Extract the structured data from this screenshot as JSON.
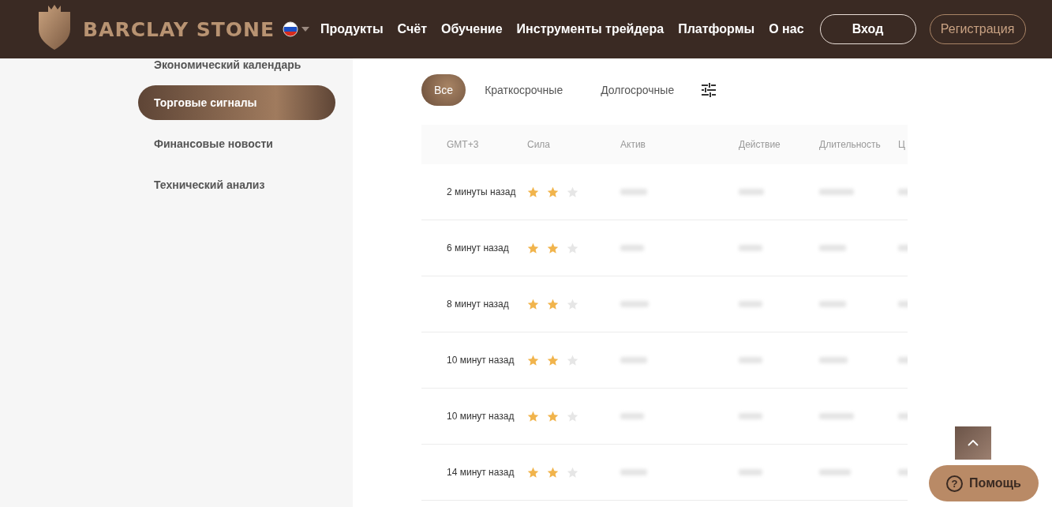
{
  "header": {
    "logo": "BARCLAY STONE",
    "nav": [
      "Продукты",
      "Счёт",
      "Обучение",
      "Инструменты трейдера",
      "Платформы",
      "О нас"
    ],
    "login": "Вход",
    "register": "Регистрация"
  },
  "sidebar": {
    "items": [
      {
        "label": "Экономический календарь",
        "selected": false
      },
      {
        "label": "Торговые сигналы",
        "selected": true
      },
      {
        "label": "Финансовые новости",
        "selected": false
      },
      {
        "label": "Технический анализ",
        "selected": false
      }
    ]
  },
  "tabs": [
    {
      "label": "Все",
      "selected": true
    },
    {
      "label": "Краткосрочные",
      "selected": false
    },
    {
      "label": "Долгосрочные",
      "selected": false
    }
  ],
  "table": {
    "columns": [
      "GMT+3",
      "Сила",
      "Актив",
      "Действие",
      "Длительность",
      "Ц"
    ],
    "rows": [
      {
        "time": "2 минуты назад",
        "stars": 2
      },
      {
        "time": "6 минут назад",
        "stars": 2
      },
      {
        "time": "8 минут назад",
        "stars": 2
      },
      {
        "time": "10 минут назад",
        "stars": 2
      },
      {
        "time": "10 минут назад",
        "stars": 2
      },
      {
        "time": "14 минут назад",
        "stars": 2
      }
    ]
  },
  "help_button": {
    "icon": "?",
    "label": "Помощь"
  }
}
